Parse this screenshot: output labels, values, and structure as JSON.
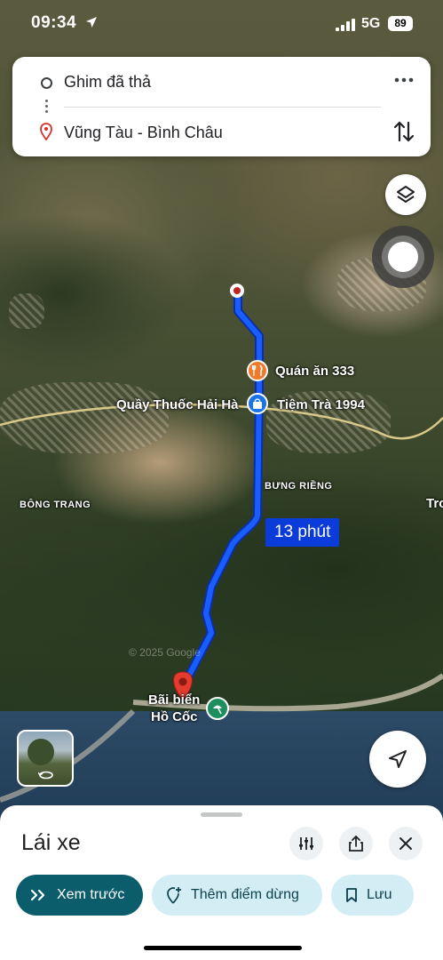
{
  "status_bar": {
    "time": "09:34",
    "network": "5G",
    "battery": "89"
  },
  "directions": {
    "origin": "Ghim đã thả",
    "destination": "Vũng Tàu - Bình Châu"
  },
  "map": {
    "route_duration": "13 phút",
    "poi": [
      {
        "name": "Quán ăn 333",
        "icon": "fork-knife-icon",
        "color": "#f07a2a"
      },
      {
        "name": "Quầy Thuốc Hải Hà",
        "icon": "shopping-bag-icon",
        "color": "#1a73e8"
      },
      {
        "name": "Tiệm Trà 1994",
        "icon": "shopping-bag-icon",
        "color": "#1a73e8"
      }
    ],
    "areas": {
      "bung_rieng": "BƯNG RIỀNG",
      "bong_trang": "BÔNG TRANG",
      "edge": "Tro"
    },
    "destination_label_line1": "Bãi biển",
    "destination_label_line2": "Hồ Cốc",
    "route_color": "#1a5dff",
    "destination_pin_color": "#e33b2e",
    "park_pin_color": "#1e8e5e",
    "copyright": "© 2025 Google"
  },
  "bottom_sheet": {
    "title": "Lái xe",
    "actions": {
      "preview": "Xem trước",
      "add_stop": "Thêm điểm dừng",
      "save": "Lưu"
    }
  }
}
